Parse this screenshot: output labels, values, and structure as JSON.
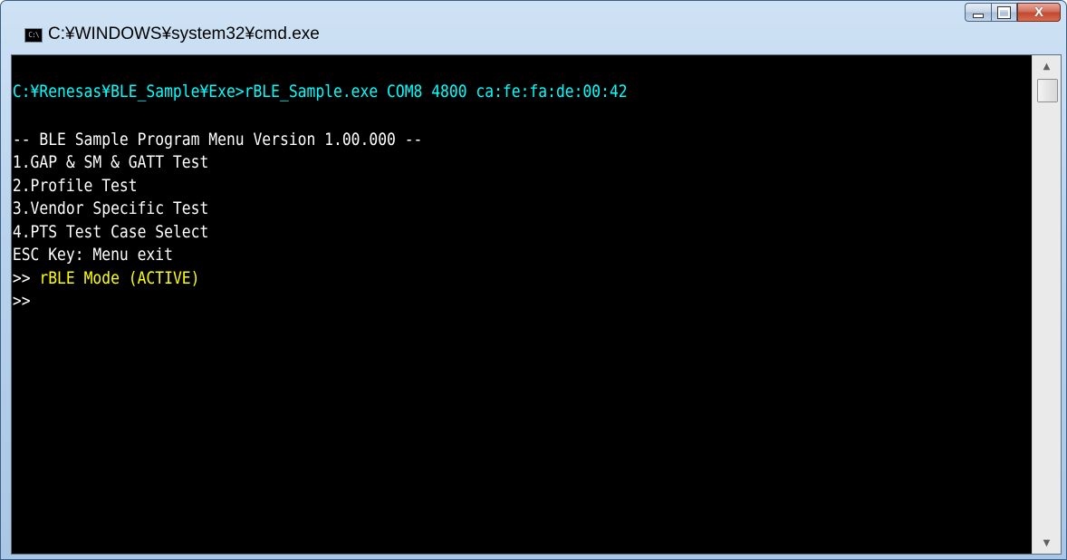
{
  "window": {
    "title": "C:¥WINDOWS¥system32¥cmd.exe",
    "icon_text": "C:\\",
    "buttons": {
      "minimize": "minimize",
      "maximize": "maximize",
      "close": "X"
    }
  },
  "console": {
    "command_line": "C:¥Renesas¥BLE_Sample¥Exe>rBLE_Sample.exe COM8 4800 ca:fe:fa:de:00:42",
    "menu_header": "-- BLE Sample Program Menu Version 1.00.000 --",
    "menu_items": [
      "1.GAP & SM & GATT Test",
      "2.Profile Test",
      "3.Vendor Specific Test",
      "4.PTS Test Case Select"
    ],
    "esc_hint": "ESC Key: Menu exit",
    "mode_prompt": ">>",
    "mode_text": " rBLE Mode (ACTIVE)",
    "input_prompt": ">>"
  },
  "colors": {
    "command": "#00ffff",
    "normal": "#ffffff",
    "highlight": "#ffff00",
    "background": "#000000"
  },
  "scrollbar": {
    "up_arrow": "▲",
    "down_arrow": "▼"
  }
}
